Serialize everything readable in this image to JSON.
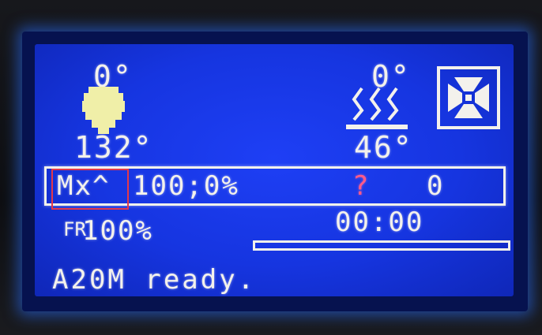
{
  "hotend": {
    "target": "0°",
    "current": "132°"
  },
  "bed": {
    "target": "0°",
    "current": "46°"
  },
  "status_line": {
    "axis_label": "Mx^",
    "axis_value": "100;0%",
    "sd_glyph": "?",
    "sd_count": "0"
  },
  "feedrate": {
    "label": "FR",
    "value": "100%"
  },
  "print": {
    "elapsed": "00:00",
    "progress_percent": 0
  },
  "message": "A20M ready.",
  "colors": {
    "lcd_blue": "#1635e0",
    "lcd_text": "#f3f1ec",
    "highlight_box": "#e2384b"
  },
  "icons": {
    "hotend": "nozzle-icon",
    "bed": "heated-bed-icon",
    "fan": "fan-icon"
  }
}
